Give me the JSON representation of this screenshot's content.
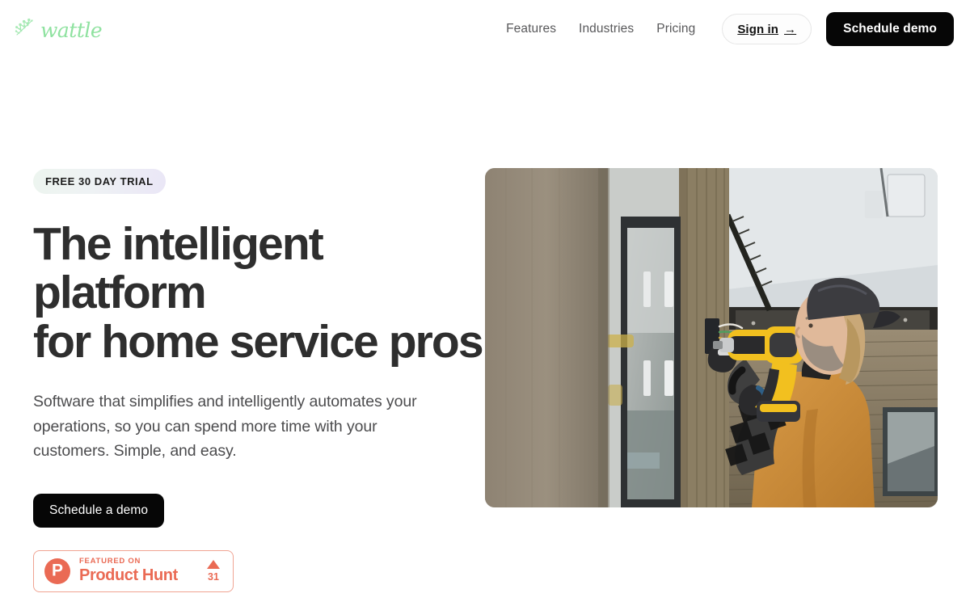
{
  "header": {
    "brand": {
      "name": "wattle",
      "icon": "wattle-sprig-icon",
      "color": "#8fe2a0"
    },
    "nav_links": [
      {
        "label": "Features"
      },
      {
        "label": "Industries"
      },
      {
        "label": "Pricing"
      }
    ],
    "sign_in": {
      "label": "Sign in",
      "arrow": "→"
    },
    "schedule_demo": {
      "label": "Schedule demo"
    }
  },
  "hero": {
    "badge": {
      "label": "FREE 30 DAY TRIAL"
    },
    "title_line1": "The intelligent platform",
    "title_line2": "for home service pros",
    "subtitle": "Software that simplifies and intelligently automates your operations, so you can spend more time with your customers. Simple, and easy.",
    "cta": {
      "label": "Schedule a demo"
    },
    "product_hunt": {
      "logo_letter": "P",
      "featured_label": "FEATURED ON",
      "name": "Product Hunt",
      "upvote_count": "31",
      "color": "#ea6a54"
    },
    "image": {
      "alt": "Tradesperson in a tan work vest and plaid shirt using a yellow cordless drill to install a fixture on wooden siding beside a window"
    }
  },
  "colors": {
    "text_dark": "#2e2e2e",
    "text_muted": "#59595b",
    "button_black": "#060606",
    "brand_green": "#8fe2a0",
    "product_hunt": "#ea6a54",
    "badge_gradient_start": "#edf5ef",
    "badge_gradient_end": "#eae6f6"
  }
}
